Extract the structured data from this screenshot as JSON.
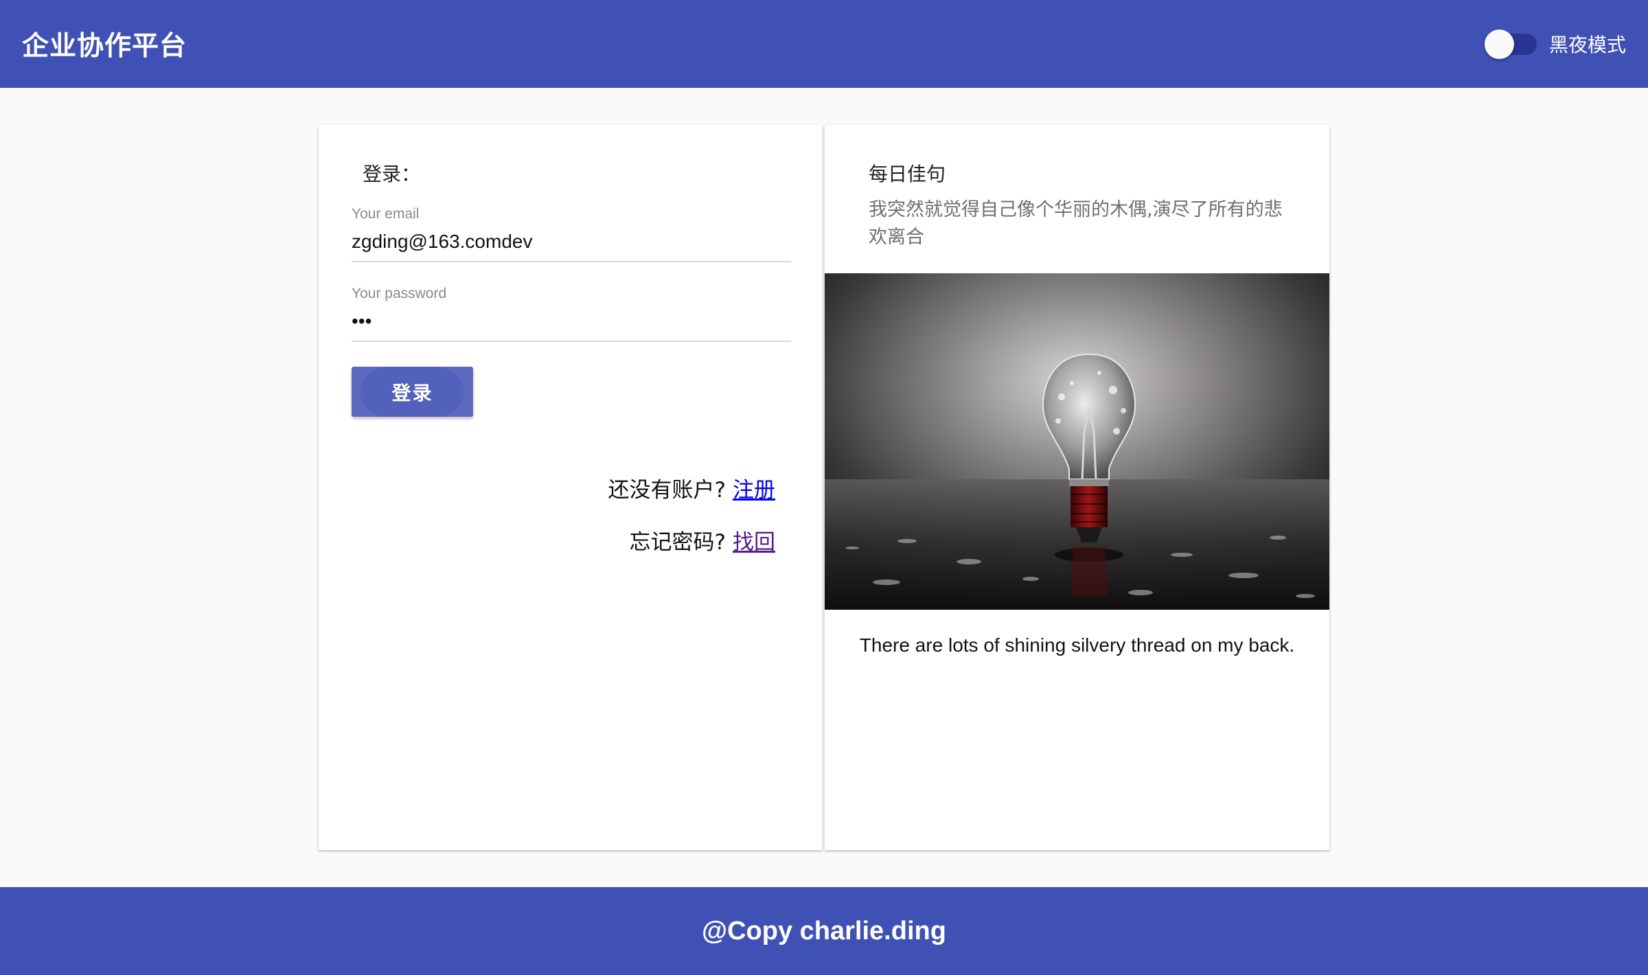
{
  "header": {
    "app_title": "企业协作平台",
    "dark_mode_label": "黑夜模式",
    "dark_mode_on": false
  },
  "login": {
    "heading": "登录：",
    "email_label": "Your email",
    "email_value": "zgding@163.comdev",
    "password_label": "Your password",
    "password_value": "•••",
    "submit_label": "登录",
    "register_prompt": "还没有账户?",
    "register_link": "注册",
    "recover_prompt": "忘记密码?",
    "recover_link": "找回"
  },
  "quote": {
    "title": "每日佳句",
    "text": "我突然就觉得自己像个华丽的木偶,演尽了所有的悲欢离合",
    "image_icon": "light-bulb-photo",
    "caption": "There are lots of shining silvery thread on my back."
  },
  "footer": {
    "text": "@Copy charlie.ding"
  },
  "colors": {
    "primary": "#3f51b5",
    "primary_light": "#5c6bc0",
    "page_background": "#fafafa"
  }
}
